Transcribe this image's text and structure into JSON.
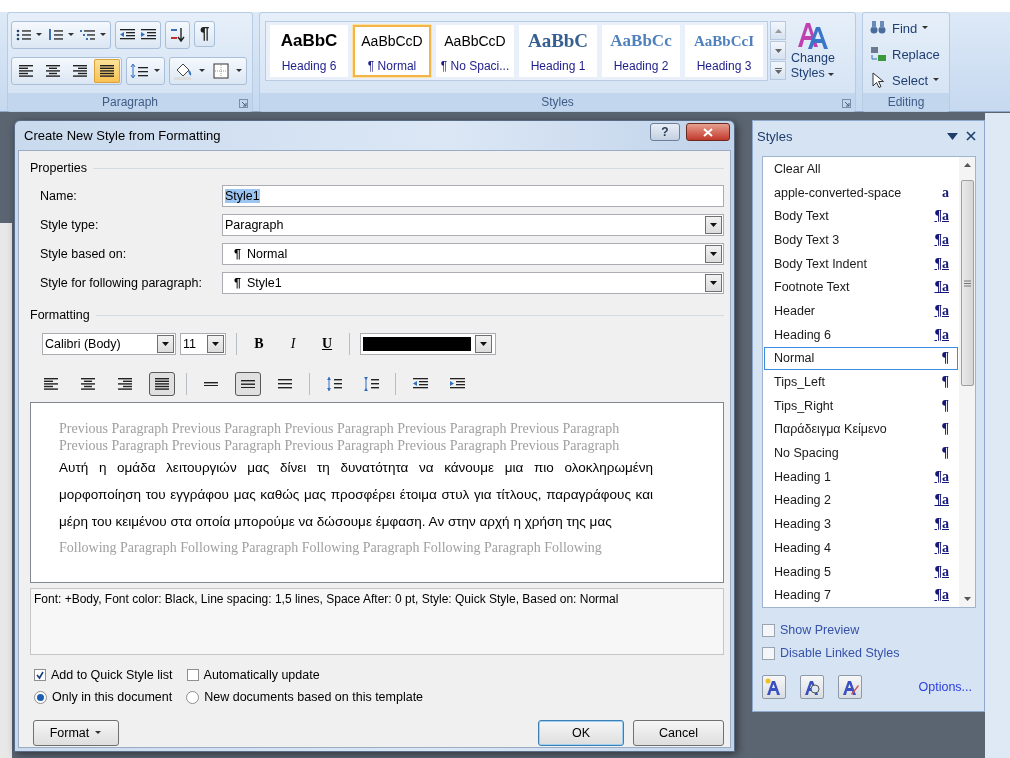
{
  "ribbon": {
    "paragraph_group": {
      "label": "Paragraph",
      "show_marks": "¶",
      "alignment_buttons": [
        {
          "kind": "left",
          "selected": false
        },
        {
          "kind": "center",
          "selected": false
        },
        {
          "kind": "right",
          "selected": false
        },
        {
          "kind": "justify",
          "selected": true
        }
      ]
    },
    "styles_group": {
      "label": "Styles",
      "change_styles": "Change Styles",
      "gallery": [
        {
          "kind": "heading6",
          "preview": "AaBbC",
          "label": "Heading 6",
          "selected": false
        },
        {
          "kind": "normal",
          "preview": "AaBbCcD",
          "label": "¶ Normal",
          "selected": true
        },
        {
          "kind": "normal",
          "preview": "AaBbCcD",
          "label": "¶ No Spaci...",
          "selected": false
        },
        {
          "kind": "heading1",
          "preview": "AaBbC",
          "label": "Heading 1",
          "selected": false
        },
        {
          "kind": "heading2",
          "preview": "AaBbCc",
          "label": "Heading 2",
          "selected": false
        },
        {
          "kind": "heading3",
          "preview": "AaBbCcI",
          "label": "Heading 3",
          "selected": false
        }
      ]
    },
    "editing_group": {
      "label": "Editing",
      "commands": [
        {
          "kind": "find",
          "label": "Find"
        },
        {
          "kind": "replace",
          "label": "Replace"
        },
        {
          "kind": "select",
          "label": "Select"
        }
      ]
    }
  },
  "dialog": {
    "title": "Create New Style from Formatting",
    "help": "?",
    "properties": {
      "label": "Properties",
      "fields": [
        {
          "kind": "text",
          "label": "Name:",
          "value": "Style1",
          "highlighted": true
        },
        {
          "kind": "dropdown",
          "label": "Style type:",
          "value": "Paragraph"
        },
        {
          "kind": "style-dropdown",
          "label": "Style based on:",
          "marker": "¶",
          "value": "Normal"
        },
        {
          "kind": "style-dropdown",
          "label": "Style for following paragraph:",
          "marker": "¶",
          "value": "Style1"
        }
      ]
    },
    "formatting": {
      "label": "Formatting",
      "font": "Calibri (Body)",
      "size": "11",
      "bold": "B",
      "italic": "I",
      "underline": "U",
      "alignment_buttons": [
        {
          "kind": "left",
          "selected": false
        },
        {
          "kind": "center",
          "selected": false
        },
        {
          "kind": "right",
          "selected": false
        },
        {
          "kind": "justify",
          "selected": true
        }
      ],
      "line_spacing_buttons": [
        {
          "kind": "single",
          "selected": false
        },
        {
          "kind": "one-half",
          "selected": true
        },
        {
          "kind": "double",
          "selected": false
        }
      ]
    },
    "preview": {
      "previous": "Previous Paragraph Previous Paragraph Previous Paragraph Previous Paragraph Previous Paragraph Previous Paragraph Previous Paragraph Previous Paragraph Previous Paragraph Previous Paragraph",
      "sample": "Αυτή η ομάδα λειτουργιών μας δίνει τη δυνατότητα να κάνουμε μια πιο ολοκληρωμένη μορφοποίηση του εγγράφου μας καθώς μας προσφέρει έτοιμα στυλ για τίτλους, παραγράφους και μέρη του κειμένου στα οποία μπορούμε να δώσουμε έμφαση. Αν στην αρχή η χρήση της μας",
      "following": "Following Paragraph Following Paragraph Following Paragraph Following Paragraph Following"
    },
    "description": "Font: +Body, Font color: Black, Line spacing:  1,5 lines, Space After:  0 pt, Style: Quick Style, Based on: Normal",
    "checkboxes": [
      {
        "label": "Add to Quick Style list",
        "checked": true
      },
      {
        "label": "Automatically update",
        "checked": false
      }
    ],
    "radios": [
      {
        "label": "Only in this document",
        "selected": true
      },
      {
        "label": "New documents based on this template",
        "selected": false
      }
    ],
    "buttons": {
      "format": "Format",
      "ok": "OK",
      "cancel": "Cancel"
    }
  },
  "styles_pane": {
    "title": "Styles",
    "items": [
      {
        "kind": "none",
        "name": "Clear All",
        "selected": false
      },
      {
        "kind": "character",
        "name": "apple-converted-space",
        "marker": "a",
        "selected": false
      },
      {
        "kind": "linked",
        "name": "Body Text",
        "marker": "¶a",
        "selected": false
      },
      {
        "kind": "linked",
        "name": "Body Text 3",
        "marker": "¶a",
        "selected": false
      },
      {
        "kind": "linked",
        "name": "Body Text Indent",
        "marker": "¶a",
        "selected": false
      },
      {
        "kind": "linked",
        "name": "Footnote Text",
        "marker": "¶a",
        "selected": false
      },
      {
        "kind": "linked",
        "name": "Header",
        "marker": "¶a",
        "selected": false
      },
      {
        "kind": "linked",
        "name": "Heading 6",
        "marker": "¶a",
        "selected": false
      },
      {
        "kind": "paragraph",
        "name": "Normal",
        "marker": "¶",
        "selected": true
      },
      {
        "kind": "paragraph",
        "name": "Tips_Left",
        "marker": "¶",
        "selected": false
      },
      {
        "kind": "paragraph",
        "name": "Tips_Right",
        "marker": "¶",
        "selected": false
      },
      {
        "kind": "paragraph",
        "name": "Παράδειγμα Κείμενο",
        "marker": "¶",
        "selected": false
      },
      {
        "kind": "paragraph",
        "name": "No Spacing",
        "marker": "¶",
        "selected": false
      },
      {
        "kind": "linked",
        "name": "Heading 1",
        "marker": "¶a",
        "selected": false
      },
      {
        "kind": "linked",
        "name": "Heading 2",
        "marker": "¶a",
        "selected": false
      },
      {
        "kind": "linked",
        "name": "Heading 3",
        "marker": "¶a",
        "selected": false
      },
      {
        "kind": "linked",
        "name": "Heading 4",
        "marker": "¶a",
        "selected": false
      },
      {
        "kind": "linked",
        "name": "Heading 5",
        "marker": "¶a",
        "selected": false
      },
      {
        "kind": "linked",
        "name": "Heading 7",
        "marker": "¶a",
        "selected": false
      }
    ],
    "checkboxes": [
      {
        "label": "Show Preview",
        "checked": false
      },
      {
        "label": "Disable Linked Styles",
        "checked": false
      }
    ],
    "options_link": "Options..."
  }
}
